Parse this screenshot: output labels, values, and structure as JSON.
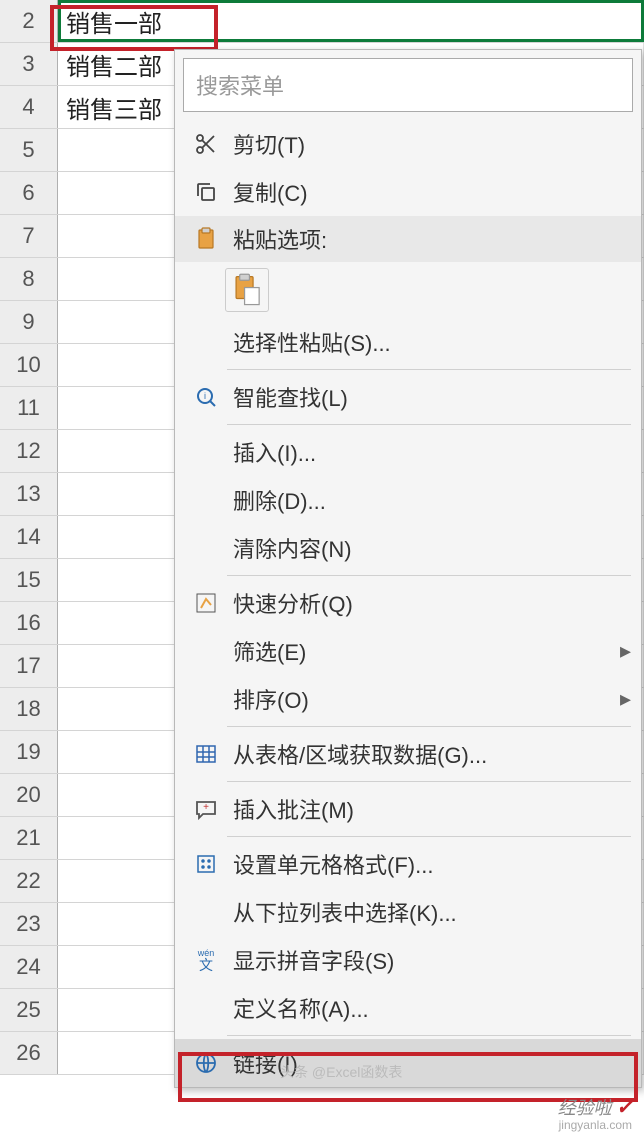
{
  "rows": {
    "r2": "2",
    "r3": "3",
    "r4": "4",
    "r5": "5",
    "r6": "6",
    "r7": "7",
    "r8": "8",
    "r9": "9",
    "r10": "10",
    "r11": "11",
    "r12": "12",
    "r13": "13",
    "r14": "14",
    "r15": "15",
    "r16": "16",
    "r17": "17",
    "r18": "18",
    "r19": "19",
    "r20": "20",
    "r21": "21",
    "r22": "22",
    "r23": "23",
    "r24": "24",
    "r25": "25",
    "r26": "26"
  },
  "cells": {
    "b2": "销售一部",
    "b3": "销售二部",
    "b4": "销售三部"
  },
  "menu": {
    "search_placeholder": "搜索菜单",
    "cut": "剪切(T)",
    "copy": "复制(C)",
    "paste_options": "粘贴选项:",
    "paste_special": "选择性粘贴(S)...",
    "smart_lookup": "智能查找(L)",
    "insert": "插入(I)...",
    "delete": "删除(D)...",
    "clear_contents": "清除内容(N)",
    "quick_analysis": "快速分析(Q)",
    "filter": "筛选(E)",
    "sort": "排序(O)",
    "get_data": "从表格/区域获取数据(G)...",
    "insert_comment": "插入批注(M)",
    "format_cells": "设置单元格格式(F)...",
    "pick_from_list": "从下拉列表中选择(K)...",
    "show_pinyin": "显示拼音字段(S)",
    "define_name": "定义名称(A)...",
    "link": "链接(I)"
  },
  "watermark": {
    "main": "经验啦",
    "sub": "jingyanla.com",
    "toutiao": "头条 @Excel函数表"
  }
}
